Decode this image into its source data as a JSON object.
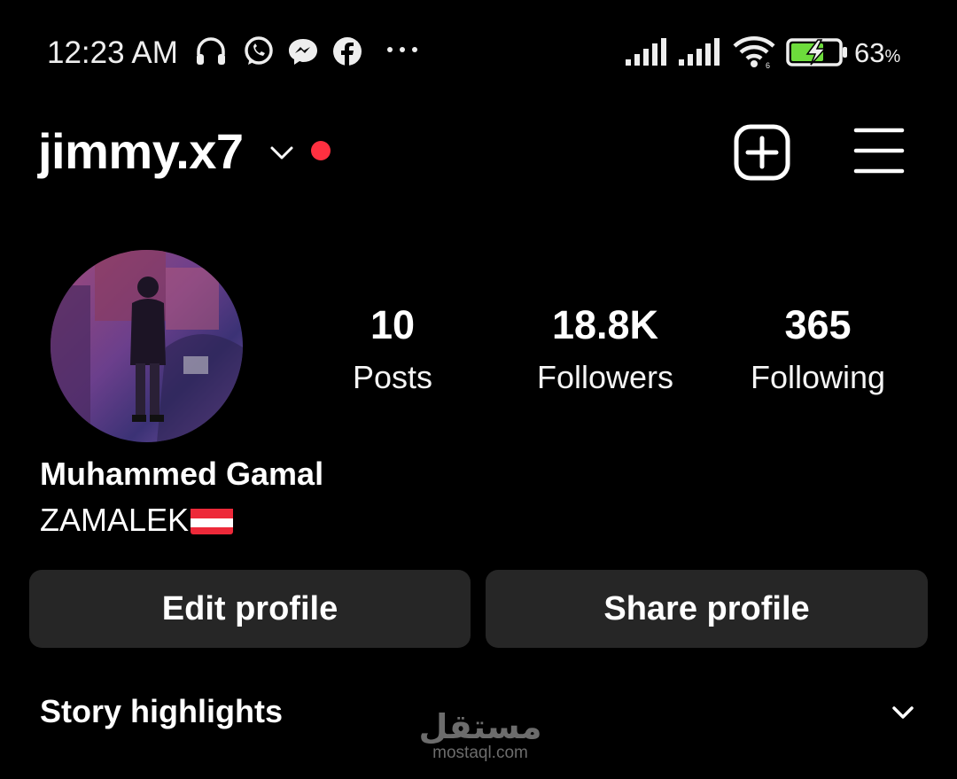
{
  "status_bar": {
    "time": "12:23 AM",
    "battery_percent": "63",
    "battery_unit": "%",
    "icons": [
      "headphones-icon",
      "whatsapp-icon",
      "messenger-icon",
      "facebook-icon",
      "more-dots-icon",
      "signal-icon",
      "signal-icon",
      "wifi-icon",
      "battery-charging-icon"
    ]
  },
  "header": {
    "username": "jimmy.x7",
    "icons": [
      "chevron-down-icon",
      "notification-dot",
      "add-post-icon",
      "menu-icon"
    ],
    "notification_color": "#ff3040"
  },
  "profile": {
    "stats": [
      {
        "value": "10",
        "label": "Posts"
      },
      {
        "value": "18.8K",
        "label": "Followers"
      },
      {
        "value": "365",
        "label": "Following"
      }
    ],
    "full_name": "Muhammed Gamal",
    "bio": "ZAMALEK"
  },
  "actions": {
    "edit_label": "Edit profile",
    "share_label": "Share profile"
  },
  "highlights": {
    "title": "Story highlights"
  },
  "watermark": {
    "arabic": "مستقل",
    "latin": "mostaql.com"
  },
  "colors": {
    "background": "#000000",
    "button_bg": "#262626",
    "accent_dot": "#ff3040"
  }
}
